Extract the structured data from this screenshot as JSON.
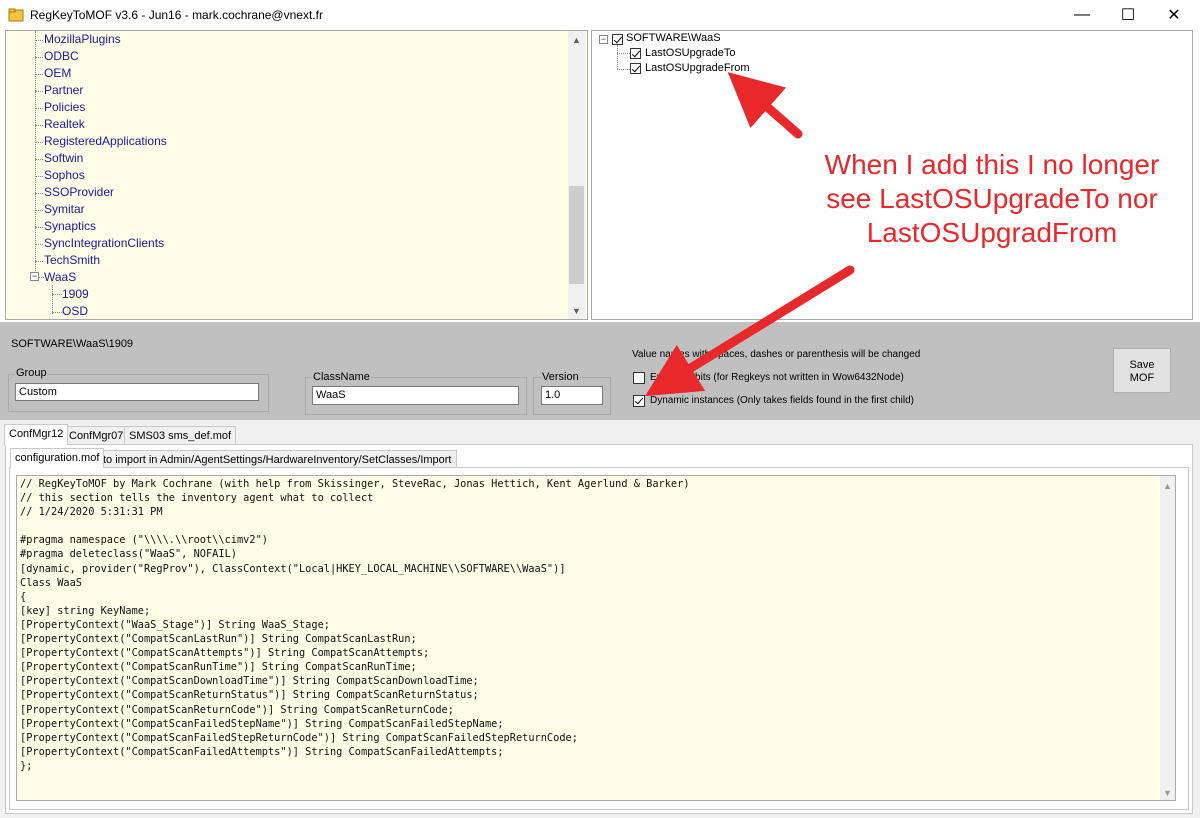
{
  "window": {
    "title": "RegKeyToMOF v3.6 - Jun16 - mark.cochrane@vnext.fr",
    "controls": {
      "minimize": "—",
      "maximize": "☐",
      "close": "✕"
    }
  },
  "left_tree": {
    "items": [
      "MozillaPlugins",
      "ODBC",
      "OEM",
      "Partner",
      "Policies",
      "Realtek",
      "RegisteredApplications",
      "Softwin",
      "Sophos",
      "SSOProvider",
      "Symitar",
      "Synaptics",
      "SyncIntegrationClients",
      "TechSmith"
    ],
    "expanded": {
      "label": "WaaS",
      "expander": "−",
      "children": [
        "1909",
        "OSD"
      ]
    }
  },
  "right_tree": {
    "root": {
      "label": "SOFTWARE\\WaaS",
      "checked": true,
      "expander": "−"
    },
    "children": [
      {
        "label": "LastOSUpgradeTo",
        "checked": true
      },
      {
        "label": "LastOSUpgradeFrom",
        "checked": true
      }
    ]
  },
  "details": {
    "selected_path": "SOFTWARE\\WaaS\\1909",
    "group": {
      "label": "Group",
      "value": "Custom"
    },
    "classname": {
      "label": "ClassName",
      "value": "WaaS"
    },
    "version": {
      "label": "Version",
      "value": "1.0"
    },
    "note": "Value names with spaces, dashes or parenthesis will be changed",
    "enable64": {
      "label": "Enable 64bits (for Regkeys not written in Wow6432Node)",
      "checked": false
    },
    "dynamic": {
      "label": "Dynamic instances (Only takes fields found in the first child)",
      "checked": true
    },
    "save_button": "Save\nMOF"
  },
  "tabs": {
    "outer": [
      "ConfMgr12",
      "ConfMgr07",
      "SMS03 sms_def.mof"
    ],
    "outer_active": 0,
    "inner": [
      "configuration.mof",
      "to import in Admin/AgentSettings/HardwareInventory/SetClasses/Import"
    ],
    "inner_active": 0
  },
  "code": "// RegKeyToMOF by Mark Cochrane (with help from Skissinger, SteveRac, Jonas Hettich, Kent Agerlund & Barker)\n// this section tells the inventory agent what to collect\n// 1/24/2020 5:31:31 PM\n\n#pragma namespace (\"\\\\\\\\.\\\\root\\\\cimv2\")\n#pragma deleteclass(\"WaaS\", NOFAIL)\n[dynamic, provider(\"RegProv\"), ClassContext(\"Local|HKEY_LOCAL_MACHINE\\\\SOFTWARE\\\\WaaS\")]\nClass WaaS\n{\n[key] string KeyName;\n[PropertyContext(\"WaaS_Stage\")] String WaaS_Stage;\n[PropertyContext(\"CompatScanLastRun\")] String CompatScanLastRun;\n[PropertyContext(\"CompatScanAttempts\")] String CompatScanAttempts;\n[PropertyContext(\"CompatScanRunTime\")] String CompatScanRunTime;\n[PropertyContext(\"CompatScanDownloadTime\")] String CompatScanDownloadTime;\n[PropertyContext(\"CompatScanReturnStatus\")] String CompatScanReturnStatus;\n[PropertyContext(\"CompatScanReturnCode\")] String CompatScanReturnCode;\n[PropertyContext(\"CompatScanFailedStepName\")] String CompatScanFailedStepName;\n[PropertyContext(\"CompatScanFailedStepReturnCode\")] String CompatScanFailedStepReturnCode;\n[PropertyContext(\"CompatScanFailedAttempts\")] String CompatScanFailedAttempts;\n};",
  "annotation": {
    "text": "When I add this I no longer see LastOSUpgradeTo nor LastOSUpgradFrom",
    "color": "#e8282b"
  },
  "colors": {
    "tree_link": "#1a1a9c",
    "pane_bg": "#fffde7",
    "panel_grey": "#c0c0c0"
  }
}
